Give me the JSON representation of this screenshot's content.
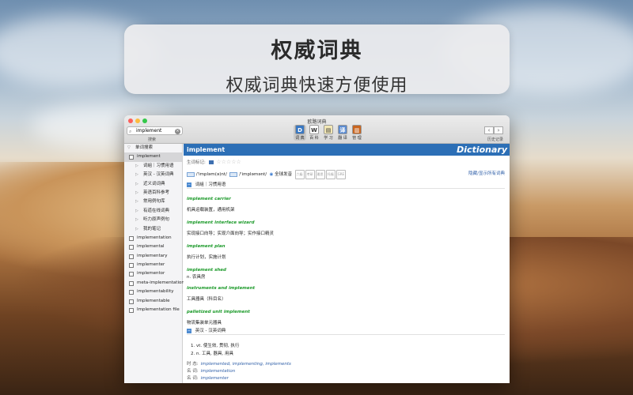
{
  "banner": {
    "title": "权威词典",
    "subtitle": "权威词典快速方便使用"
  },
  "window": {
    "title": "欧路词典",
    "search": {
      "value": "implement",
      "label": "搜索"
    },
    "toolbar": [
      {
        "label": "词 典",
        "color": "#3a78c2",
        "glyph": "D",
        "selected": true
      },
      {
        "label": "百 科",
        "color": "#ffffff",
        "glyph": "W",
        "selected": false
      },
      {
        "label": "学 习",
        "color": "#f2e7b5",
        "glyph": "▤",
        "selected": false
      },
      {
        "label": "翻 译",
        "color": "#5b8bd0",
        "glyph": "译",
        "selected": false
      },
      {
        "label": "管 理",
        "color": "#c9651f",
        "glyph": "▥",
        "selected": false
      }
    ],
    "history_label": "历史记录",
    "nav": {
      "back": "‹",
      "forward": "›"
    }
  },
  "sidebar": {
    "header": "单词搜索",
    "selected": "implement",
    "children": [
      "词組｜习惯用语",
      "英汉 - 汉英词典",
      "近义词词典",
      "英语百科参考",
      "常用例句库",
      "有道在线词典",
      "听力原声例句",
      "我的笔记"
    ],
    "words": [
      "implementation",
      "implemental",
      "implementary",
      "implementer",
      "implementor",
      "meta-implementation",
      "implementability",
      "Implementable",
      "Implementation file"
    ]
  },
  "entry": {
    "word": "implement",
    "brand": "Dictionary",
    "star_label": "生词标记:",
    "stars": 0,
    "phonetic_uk": "/'impləm(ə)nt/",
    "phonetic_us": "/'impləmənt/",
    "full_pron": "全球发音",
    "tags": [
      "六级",
      "考研",
      "雅思",
      "托福",
      "GRE"
    ],
    "hide_link": "隐藏/显示所有词典",
    "section1": "词組｜习惯用语",
    "phrases": [
      {
        "en": "implement carrier",
        "zh": "机具运载装置，通用机架"
      },
      {
        "en": "implement interface wizard",
        "zh": "实现接口向导；实现介面向导；实作接口精灵"
      },
      {
        "en": "implement plan",
        "zh": "执行计划，实施计划"
      },
      {
        "en": "implement shed",
        "zh": "n. 农具房"
      },
      {
        "en": "instruments and implement",
        "zh": "工具器具（科目名）"
      },
      {
        "en": "palletized unit implement",
        "zh": "物流集装单元器具"
      }
    ],
    "section2": "英汉 - 汉英词典",
    "defs": [
      "1.  vt. 使生效, 贯彻, 执行",
      "2.  n. 工具, 器具, 用具"
    ],
    "forms": [
      {
        "k": "时 态:",
        "v": "implemented, implementing, implements"
      },
      {
        "k": "名 词:",
        "v": "implementation"
      },
      {
        "k": "名 词:",
        "v": "implementer"
      }
    ]
  }
}
